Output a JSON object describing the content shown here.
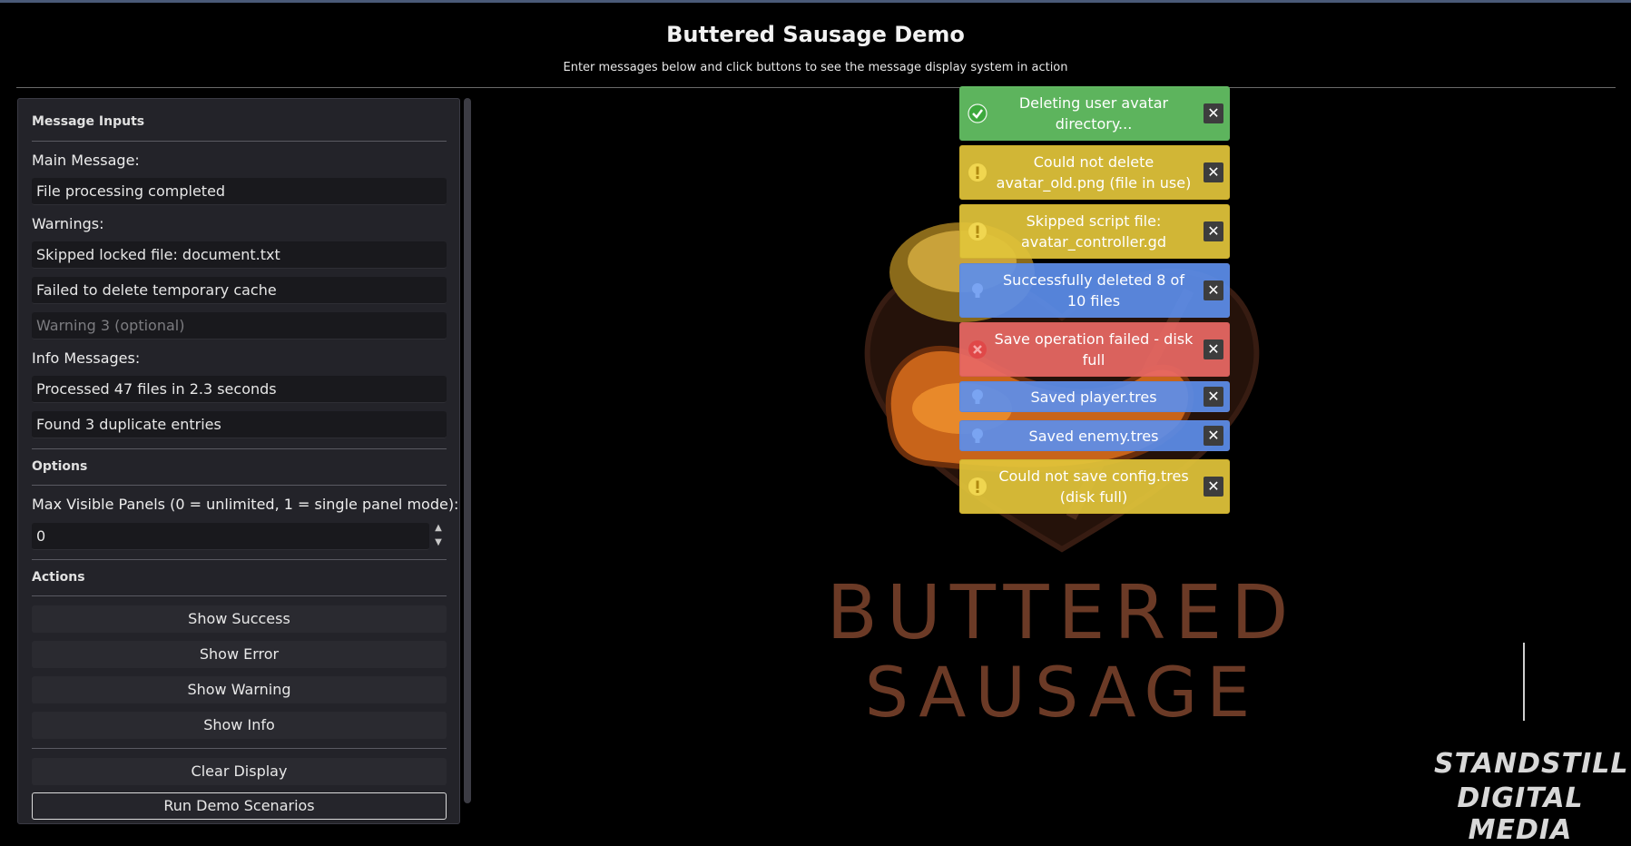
{
  "header": {
    "title": "Buttered Sausage Demo",
    "subtitle": "Enter messages below and click buttons to see the message display system in action"
  },
  "inputs": {
    "section_title": "Message Inputs",
    "main_label": "Main Message:",
    "main_value": "File processing completed",
    "warnings_label": "Warnings:",
    "warning1_value": "Skipped locked file: document.txt",
    "warning2_value": "Failed to delete temporary cache",
    "warning3_placeholder": "Warning 3 (optional)",
    "info_label": "Info Messages:",
    "info1_value": "Processed 47 files in 2.3 seconds",
    "info2_value": "Found 3 duplicate entries"
  },
  "options": {
    "section_title": "Options",
    "max_panels_label": "Max Visible Panels (0 = unlimited, 1 = single panel mode):",
    "max_panels_value": "0"
  },
  "actions": {
    "section_title": "Actions",
    "show_success": "Show Success",
    "show_error": "Show Error",
    "show_warning": "Show Warning",
    "show_info": "Show Info",
    "clear_display": "Clear Display",
    "run_demo": "Run Demo Scenarios"
  },
  "splash": {
    "line1": "BUTTERED",
    "line2": "SAUSAGE"
  },
  "brand": {
    "line1": "STANDSTILL",
    "line2": "DIGITAL MEDIA"
  },
  "toasts": [
    {
      "type": "success",
      "message": "Deleting user avatar directory...",
      "icon": "check-circle-icon"
    },
    {
      "type": "warning",
      "message": "Could not delete avatar_old.png (file in use)",
      "icon": "exclamation-icon"
    },
    {
      "type": "warning",
      "message": "Skipped script file: avatar_controller.gd",
      "icon": "exclamation-icon"
    },
    {
      "type": "info",
      "message": "Successfully deleted 8 of 10 files",
      "icon": "lightbulb-icon"
    },
    {
      "type": "error",
      "message": "Save operation failed - disk full",
      "icon": "x-circle-icon"
    },
    {
      "type": "info",
      "message": "Saved player.tres",
      "icon": "lightbulb-icon"
    },
    {
      "type": "info",
      "message": "Saved enemy.tres",
      "icon": "lightbulb-icon"
    },
    {
      "type": "warning",
      "message": "Could not save config.tres (disk full)",
      "icon": "exclamation-icon"
    }
  ],
  "colors": {
    "success": "#62be62",
    "warning": "#e1c43a",
    "info": "#5c8eec",
    "error": "#e86864"
  }
}
